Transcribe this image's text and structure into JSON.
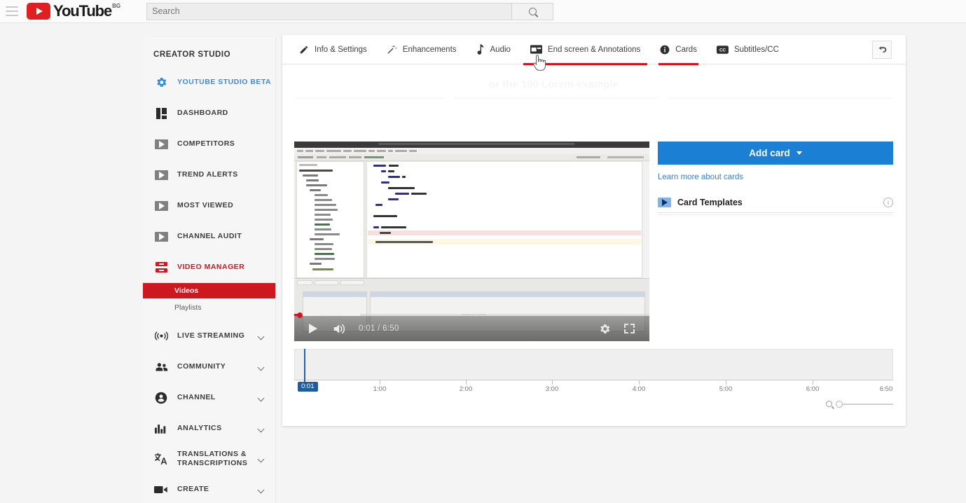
{
  "topbar": {
    "menu_icon": "hamburger-menu-icon",
    "logo_text": "YouTube",
    "logo_country": "BG",
    "search_placeholder": "Search",
    "search_value": "",
    "search_button_icon": "search-icon"
  },
  "sidebar": {
    "title": "CREATOR STUDIO",
    "items": [
      {
        "label": "YOUTUBE STUDIO BETA",
        "icon": "gear-icon",
        "style": "blue",
        "chevron": false
      },
      {
        "label": "DASHBOARD",
        "icon": "dashboard-icon",
        "style": "normal",
        "chevron": false
      },
      {
        "label": "COMPETITORS",
        "icon": "video-badge-icon",
        "style": "normal",
        "chevron": false
      },
      {
        "label": "TREND ALERTS",
        "icon": "video-badge-icon",
        "style": "normal",
        "chevron": false
      },
      {
        "label": "MOST VIEWED",
        "icon": "video-badge-icon",
        "style": "normal",
        "chevron": false
      },
      {
        "label": "CHANNEL AUDIT",
        "icon": "video-badge-icon",
        "style": "normal",
        "chevron": false
      },
      {
        "label": "VIDEO MANAGER",
        "icon": "video-manager-icon",
        "style": "red",
        "chevron": false
      },
      {
        "label": "LIVE STREAMING",
        "icon": "broadcast-icon",
        "style": "normal",
        "chevron": true
      },
      {
        "label": "COMMUNITY",
        "icon": "people-icon",
        "style": "normal",
        "chevron": true
      },
      {
        "label": "CHANNEL",
        "icon": "person-circle-icon",
        "style": "normal",
        "chevron": true
      },
      {
        "label": "ANALYTICS",
        "icon": "bar-chart-icon",
        "style": "normal",
        "chevron": true
      },
      {
        "label": "TRANSLATIONS & TRANSCRIPTIONS",
        "icon": "translate-icon",
        "style": "normal",
        "chevron": true
      },
      {
        "label": "CREATE",
        "icon": "video-camera-icon",
        "style": "normal",
        "chevron": true
      }
    ],
    "sub_items": [
      {
        "label": "Videos",
        "active": true
      },
      {
        "label": "Playlists",
        "active": false
      }
    ],
    "accent_red": "#cc181e",
    "accent_blue": "#3b8ede"
  },
  "tabs": [
    {
      "label": "Info & Settings",
      "icon": "pencil-icon",
      "active": false
    },
    {
      "label": "Enhancements",
      "icon": "magic-wand-icon",
      "active": false
    },
    {
      "label": "Audio",
      "icon": "music-note-icon",
      "active": false
    },
    {
      "label": "End screen & Annotations",
      "icon": "end-screen-icon",
      "active": false,
      "hover": true
    },
    {
      "label": "Cards",
      "icon": "info-circle-icon",
      "active": true
    },
    {
      "label": "Subtitles/CC",
      "icon": "closed-caption-icon",
      "active": false
    }
  ],
  "back_button_icon": "back-arrow-icon",
  "ghost_text": "or the 100 Lorem example",
  "player": {
    "play_icon": "play-icon",
    "volume_icon": "volume-icon",
    "time_display": "0:01 / 6:50",
    "current_time": "0:01",
    "duration": "6:50",
    "settings_icon": "gear-icon",
    "fullscreen_icon": "fullscreen-icon"
  },
  "right_panel": {
    "add_card_label": "Add card",
    "add_card_caret": "caret-down-icon",
    "add_card_color": "#1b7fd4",
    "learn_more_label": "Learn more about cards",
    "card_templates_label": "Card Templates",
    "card_templates_icon": "video-badge-icon",
    "card_templates_info_icon": "info-icon",
    "info_glyph": "i"
  },
  "timeline": {
    "playhead_label": "0:01",
    "ticks": [
      "1:00",
      "2:00",
      "3:00",
      "4:00",
      "5:00",
      "6:00"
    ],
    "end_label": "6:50",
    "zoom_icon": "magnifier-icon",
    "zoom_value": 0
  }
}
